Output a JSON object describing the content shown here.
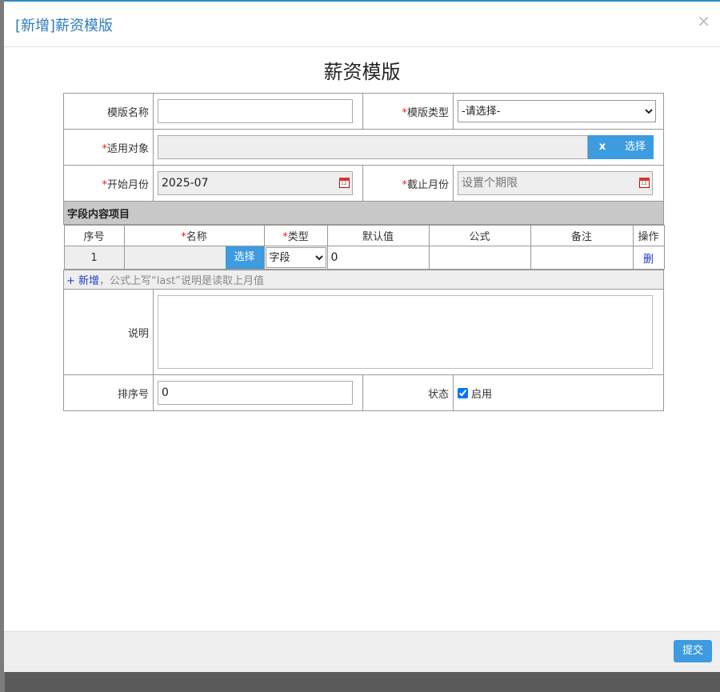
{
  "dialog": {
    "title": "[新增]薪资模版",
    "close": "×"
  },
  "form_title": "薪资模版",
  "fields": {
    "template_name": {
      "label": "模版名称",
      "value": ""
    },
    "template_type": {
      "label": "模版类型",
      "selected": "-请选择-"
    },
    "target": {
      "label": "适用对象",
      "value": "",
      "clear_label": "x",
      "select_label": "选择"
    },
    "start_month": {
      "label": "开始月份",
      "value": "2025-07"
    },
    "end_month": {
      "label": "截止月份",
      "placeholder": "设置个期限"
    },
    "description": {
      "label": "说明",
      "value": ""
    },
    "sort_no": {
      "label": "排序号",
      "value": "0"
    },
    "status": {
      "label": "状态",
      "checkbox_label": "启用",
      "checked": true
    }
  },
  "section": {
    "title": "字段内容项目",
    "headers": {
      "seq": "序号",
      "name": "名称",
      "type": "类型",
      "default": "默认值",
      "formula": "公式",
      "note": "备注",
      "ops": "操作"
    },
    "rows": [
      {
        "seq": "1",
        "name": "",
        "select_label": "选择",
        "type": "字段",
        "default": "0",
        "formula": "",
        "note": "",
        "delete_label": "删"
      }
    ],
    "add_link": "+ 新增",
    "hint": "，公式上写“last”说明是读取上月值"
  },
  "footer": {
    "submit": "提交"
  },
  "colors": {
    "accent": "#3d9be0",
    "title": "#2e7bbd",
    "required": "#e02020",
    "link": "#1a3fc9"
  }
}
